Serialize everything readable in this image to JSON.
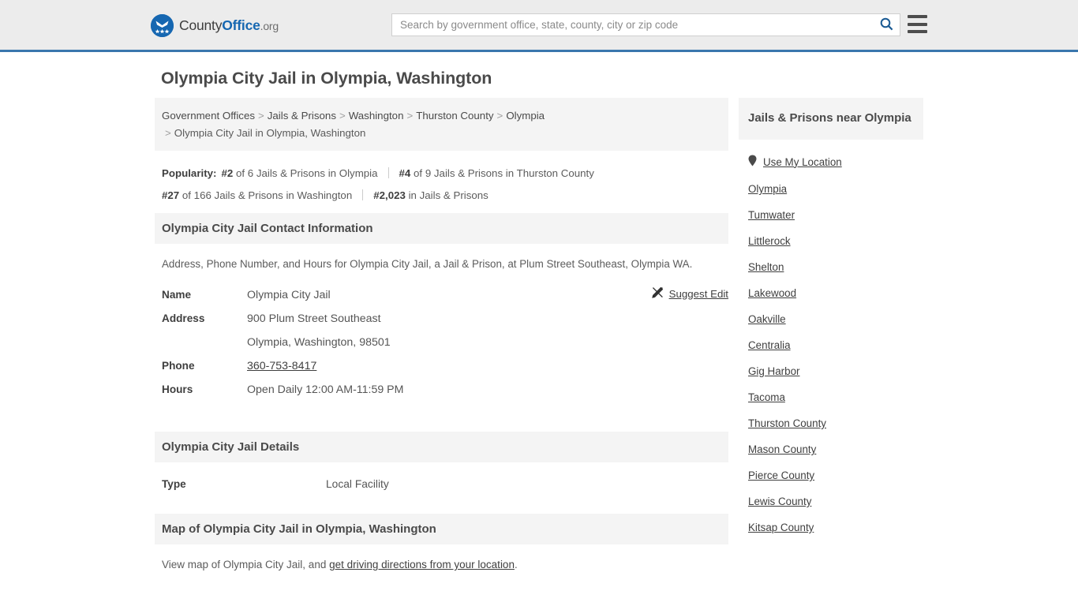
{
  "header": {
    "brand": {
      "part1": "County",
      "part2": "Office",
      "part3": ".org",
      "logo_icon": "eagle-seal-logo-icon"
    },
    "search": {
      "placeholder": "Search by government office, state, county, city or zip code",
      "value": "",
      "icon": "search-icon",
      "accent": "#1667b1"
    },
    "menu": {
      "icon": "hamburger-menu-icon"
    },
    "border_color": "#3a77ad",
    "background": "#ececec"
  },
  "page": {
    "title": "Olympia City Jail in Olympia, Washington"
  },
  "breadcrumb": {
    "separator": ">",
    "items": [
      "Government Offices",
      "Jails & Prisons",
      "Washington",
      "Thurston County",
      "Olympia"
    ],
    "current": "Olympia City Jail in Olympia, Washington"
  },
  "popularity": {
    "label": "Popularity:",
    "items": [
      {
        "rank": "#2",
        "text": "of 6 Jails & Prisons in Olympia"
      },
      {
        "rank": "#4",
        "text": "of 9 Jails & Prisons in Thurston County"
      },
      {
        "rank": "#27",
        "text": "of 166 Jails & Prisons in Washington"
      },
      {
        "rank": "#2,023",
        "text": "in Jails & Prisons"
      }
    ]
  },
  "contact_section": {
    "heading": "Olympia City Jail Contact Information",
    "description": "Address, Phone Number, and Hours for Olympia City Jail, a Jail & Prison, at Plum Street Southeast, Olympia WA.",
    "suggest_edit": {
      "label": "Suggest Edit",
      "icon": "pencil-edit-icon"
    },
    "rows": [
      {
        "label": "Name",
        "value": "Olympia City Jail"
      },
      {
        "label": "Address",
        "value": "900 Plum Street Southeast"
      },
      {
        "label": "",
        "value": "Olympia, Washington, 98501"
      },
      {
        "label": "Phone",
        "value": "360-753-8417",
        "is_link": true
      },
      {
        "label": "Hours",
        "value": "Open Daily 12:00 AM-11:59 PM"
      }
    ]
  },
  "details_section": {
    "heading": "Olympia City Jail Details",
    "rows": [
      {
        "label": "Type",
        "value": "Local Facility"
      }
    ]
  },
  "map_section": {
    "heading": "Map of Olympia City Jail in Olympia, Washington",
    "text_before": "View map of Olympia City Jail, and ",
    "link_text": "get driving directions from your location",
    "text_after": "."
  },
  "sidebar": {
    "heading": "Jails & Prisons near Olympia",
    "use_my_location": {
      "label": "Use My Location",
      "icon": "location-pin-icon"
    },
    "items": [
      "Olympia",
      "Tumwater",
      "Littlerock",
      "Shelton",
      "Lakewood",
      "Oakville",
      "Centralia",
      "Gig Harbor",
      "Tacoma",
      "Thurston County",
      "Mason County",
      "Pierce County",
      "Lewis County",
      "Kitsap County"
    ]
  }
}
